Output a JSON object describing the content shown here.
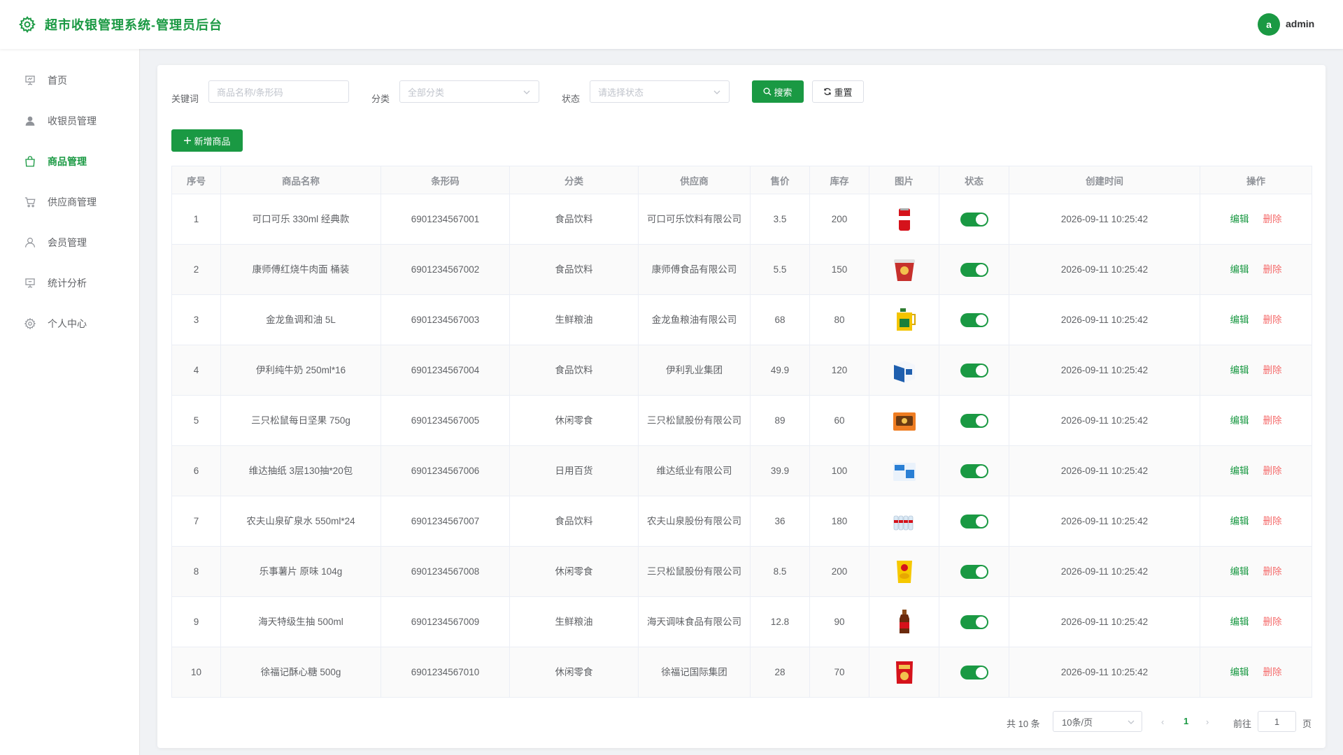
{
  "header": {
    "title": "超市收银管理系统-管理员后台",
    "avatar_letter": "a",
    "username": "admin"
  },
  "colors": {
    "primary": "#1a9943",
    "danger": "#f56c6c"
  },
  "sidebar": {
    "items": [
      {
        "label": "首页",
        "icon": "presentation-chart-icon",
        "active": false
      },
      {
        "label": "收银员管理",
        "icon": "user-icon",
        "active": false
      },
      {
        "label": "商品管理",
        "icon": "shopping-bag-icon",
        "active": true
      },
      {
        "label": "供应商管理",
        "icon": "cart-icon",
        "active": false
      },
      {
        "label": "会员管理",
        "icon": "user-outline-icon",
        "active": false
      },
      {
        "label": "统计分析",
        "icon": "presentation-icon",
        "active": false
      },
      {
        "label": "个人中心",
        "icon": "gear-icon",
        "active": false
      }
    ]
  },
  "filters": {
    "keyword_label": "关键词",
    "keyword_placeholder": "商品名称/条形码",
    "category_label": "分类",
    "category_placeholder": "全部分类",
    "status_label": "状态",
    "status_placeholder": "请选择状态",
    "search_button": "搜索",
    "reset_button": "重置"
  },
  "toolbar": {
    "add_button": "新增商品"
  },
  "table": {
    "columns": [
      "序号",
      "商品名称",
      "条形码",
      "分类",
      "供应商",
      "售价",
      "库存",
      "图片",
      "状态",
      "创建时间",
      "操作"
    ],
    "edit_label": "编辑",
    "delete_label": "删除",
    "rows": [
      {
        "no": "1",
        "name": "可口可乐 330ml 经典款",
        "barcode": "6901234567001",
        "category": "食品饮料",
        "supplier": "可口可乐饮料有限公司",
        "price": "3.5",
        "stock": "200",
        "image": "cola-can-icon",
        "status_on": true,
        "created": "2026-09-11 10:25:42"
      },
      {
        "no": "2",
        "name": "康师傅红烧牛肉面 桶装",
        "barcode": "6901234567002",
        "category": "食品饮料",
        "supplier": "康师傅食品有限公司",
        "price": "5.5",
        "stock": "150",
        "image": "noodle-cup-icon",
        "status_on": true,
        "created": "2026-09-11 10:25:42"
      },
      {
        "no": "3",
        "name": "金龙鱼调和油 5L",
        "barcode": "6901234567003",
        "category": "生鲜粮油",
        "supplier": "金龙鱼粮油有限公司",
        "price": "68",
        "stock": "80",
        "image": "oil-bottle-icon",
        "status_on": true,
        "created": "2026-09-11 10:25:42"
      },
      {
        "no": "4",
        "name": "伊利纯牛奶 250ml*16",
        "barcode": "6901234567004",
        "category": "食品饮料",
        "supplier": "伊利乳业集团",
        "price": "49.9",
        "stock": "120",
        "image": "milk-box-icon",
        "status_on": true,
        "created": "2026-09-11 10:25:42"
      },
      {
        "no": "5",
        "name": "三只松鼠每日坚果 750g",
        "barcode": "6901234567005",
        "category": "休闲零食",
        "supplier": "三只松鼠股份有限公司",
        "price": "89",
        "stock": "60",
        "image": "nut-pack-icon",
        "status_on": true,
        "created": "2026-09-11 10:25:42"
      },
      {
        "no": "6",
        "name": "维达抽纸 3层130抽*20包",
        "barcode": "6901234567006",
        "category": "日用百货",
        "supplier": "维达纸业有限公司",
        "price": "39.9",
        "stock": "100",
        "image": "tissue-pack-icon",
        "status_on": true,
        "created": "2026-09-11 10:25:42"
      },
      {
        "no": "7",
        "name": "农夫山泉矿泉水 550ml*24",
        "barcode": "6901234567007",
        "category": "食品饮料",
        "supplier": "农夫山泉股份有限公司",
        "price": "36",
        "stock": "180",
        "image": "water-bottles-icon",
        "status_on": true,
        "created": "2026-09-11 10:25:42"
      },
      {
        "no": "8",
        "name": "乐事薯片 原味 104g",
        "barcode": "6901234567008",
        "category": "休闲零食",
        "supplier": "三只松鼠股份有限公司",
        "price": "8.5",
        "stock": "200",
        "image": "chips-bag-icon",
        "status_on": true,
        "created": "2026-09-11 10:25:42"
      },
      {
        "no": "9",
        "name": "海天特级生抽 500ml",
        "barcode": "6901234567009",
        "category": "生鲜粮油",
        "supplier": "海天调味食品有限公司",
        "price": "12.8",
        "stock": "90",
        "image": "soy-sauce-bottle-icon",
        "status_on": true,
        "created": "2026-09-11 10:25:42"
      },
      {
        "no": "10",
        "name": "徐福记酥心糖 500g",
        "barcode": "6901234567010",
        "category": "休闲零食",
        "supplier": "徐福记国际集团",
        "price": "28",
        "stock": "70",
        "image": "candy-bag-icon",
        "status_on": true,
        "created": "2026-09-11 10:25:42"
      }
    ]
  },
  "pagination": {
    "total_text": "共 10 条",
    "page_size": "10条/页",
    "prev": "‹",
    "current": "1",
    "next": "›",
    "goto_label": "前往",
    "goto_value": "1",
    "page_suffix": "页"
  }
}
